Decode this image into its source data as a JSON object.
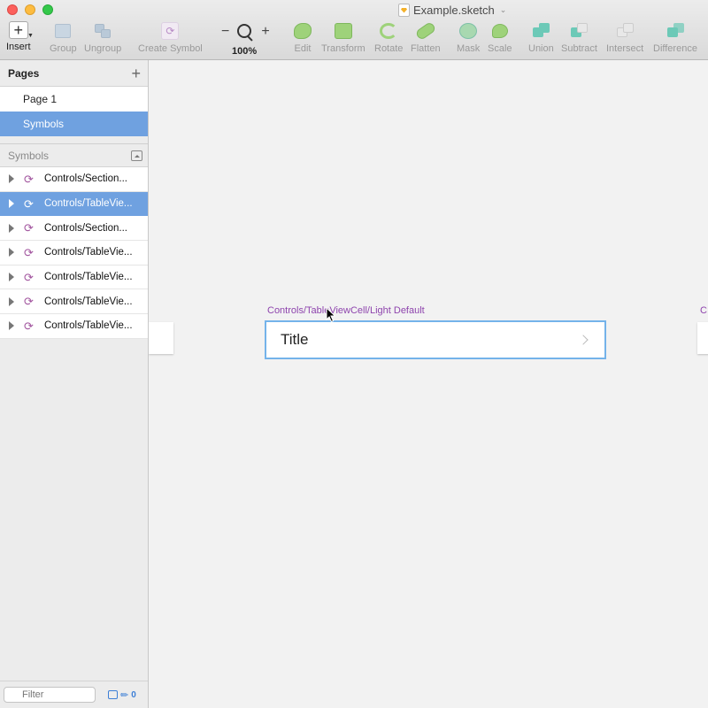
{
  "window": {
    "title": "Example.sketch"
  },
  "toolbar": {
    "insert": "Insert",
    "group": "Group",
    "ungroup": "Ungroup",
    "create_symbol": "Create Symbol",
    "zoom_minus": "−",
    "zoom_plus": "+",
    "zoom_level": "100%",
    "edit": "Edit",
    "transform": "Transform",
    "rotate": "Rotate",
    "flatten": "Flatten",
    "mask": "Mask",
    "scale": "Scale",
    "union": "Union",
    "subtract": "Subtract",
    "intersect": "Intersect",
    "difference": "Difference"
  },
  "sidebar": {
    "pages_title": "Pages",
    "add_page": "+",
    "pages": [
      {
        "label": "Page 1",
        "selected": false
      },
      {
        "label": "Symbols",
        "selected": true
      }
    ],
    "symbols_title": "Symbols",
    "layers": [
      {
        "label": "Controls/Section...",
        "selected": false
      },
      {
        "label": "Controls/TableVie...",
        "selected": true
      },
      {
        "label": "Controls/Section...",
        "selected": false
      },
      {
        "label": "Controls/TableVie...",
        "selected": false
      },
      {
        "label": "Controls/TableVie...",
        "selected": false
      },
      {
        "label": "Controls/TableVie...",
        "selected": false
      },
      {
        "label": "Controls/TableVie...",
        "selected": false
      }
    ],
    "filter_placeholder": "Filter",
    "edited_count": "0"
  },
  "canvas": {
    "artboard_label": "Controls/TableViewCell/Light Default",
    "cell_title": "Title",
    "right_stub_label": "C"
  },
  "colors": {
    "selection": "#6fa1e0",
    "artboard_label": "#8e44ad",
    "symbol_icon": "#a2569f",
    "artboard_border": "#74b3ea"
  }
}
